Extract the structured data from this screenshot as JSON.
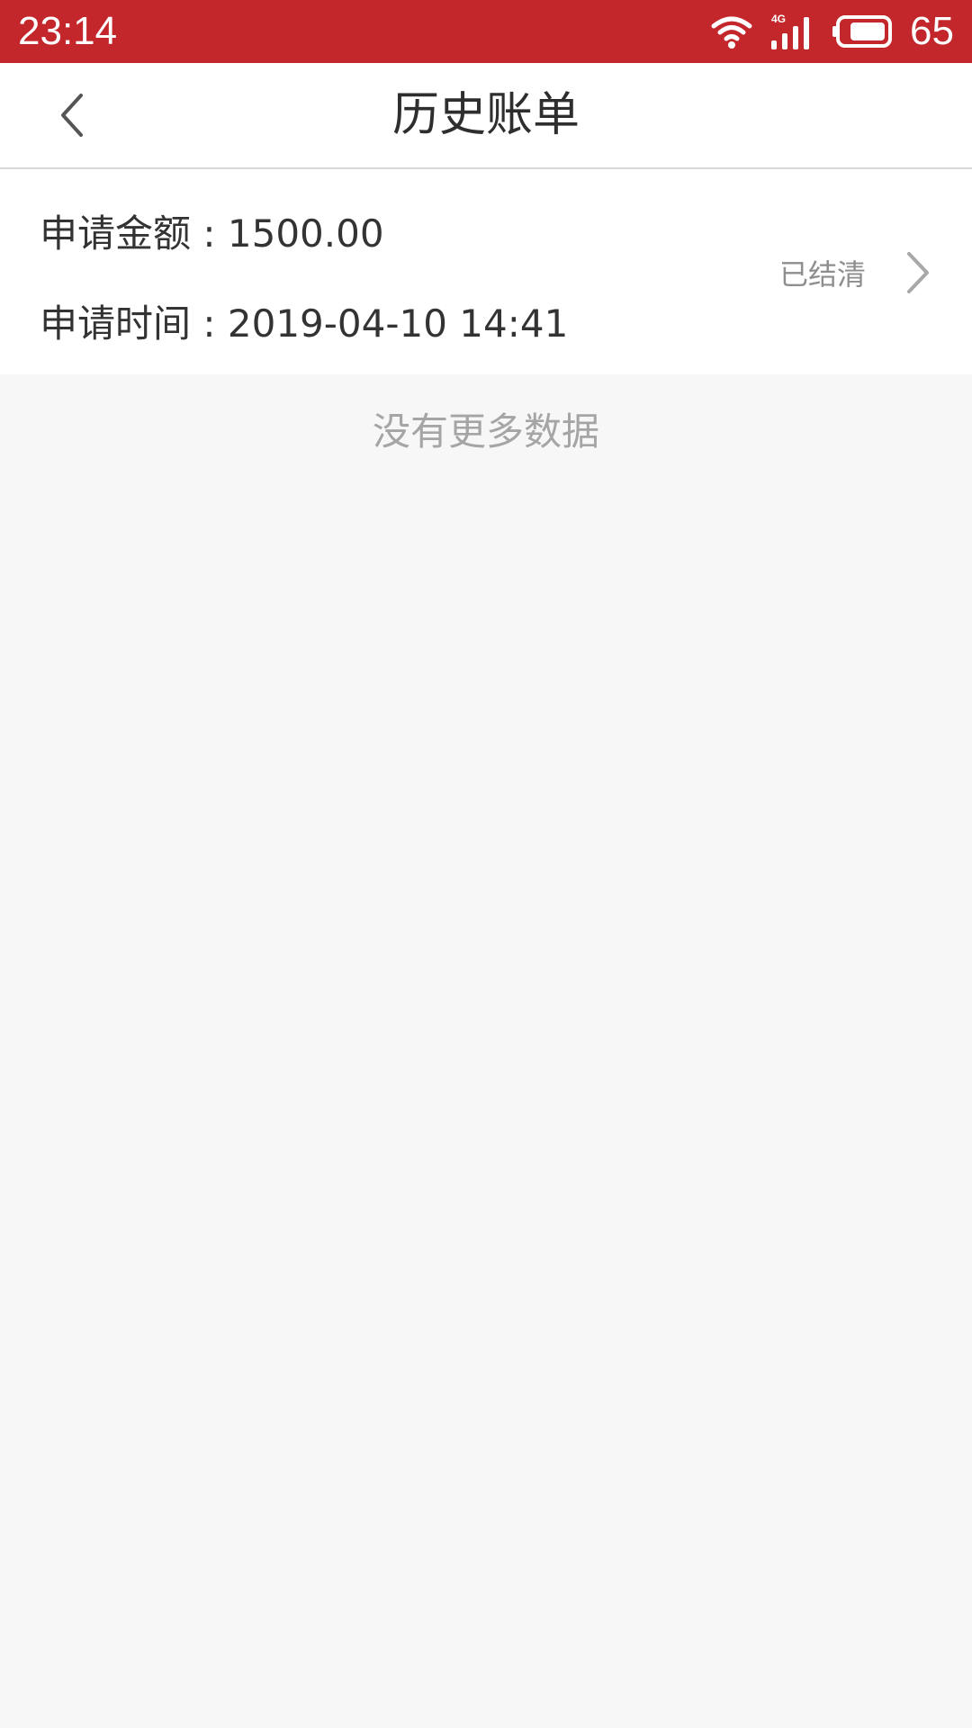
{
  "status_bar": {
    "time": "23:14",
    "network": "4G",
    "battery": "65",
    "icons": [
      "wifi-icon",
      "signal-4g-icon",
      "battery-icon"
    ],
    "color": "#c4272b"
  },
  "header": {
    "title": "历史账单",
    "back_icon": "chevron-left-icon"
  },
  "bills": [
    {
      "amount_label": "申请金额",
      "amount": "1500.00",
      "time_label": "申请时间",
      "time": "2019-04-10 14:41",
      "status": "已结清"
    }
  ],
  "empty_hint": "没有更多数据"
}
